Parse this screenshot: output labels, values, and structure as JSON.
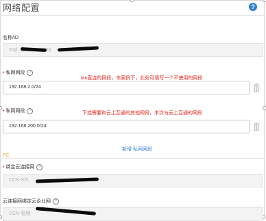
{
  "window": {
    "title": "网络配置"
  },
  "name_field": {
    "label": "名称/ID",
    "value_prefix": "sxgl",
    "value_mid": "sxg"
  },
  "private_segment_1": {
    "label": "私网网段",
    "value": "192.168.2.0/24",
    "annotation": "lan直连的网段，本案例下，此处可填写一个不使用的网段"
  },
  "private_segment_2": {
    "label": "私网网段",
    "value": "192.168.200.0/24",
    "annotation": "下挂需要和云上互通的其他网段，本次与云上互通的网段"
  },
  "add_private_segment": {
    "label": "新增 私网网段"
  },
  "section_tag": {
    "label": "PC"
  },
  "bind_ccn": {
    "label": "绑定云连接网",
    "value": "CCN-SZL"
  },
  "ccn_bound_enterprise": {
    "label": "云连接网绑定云企业网",
    "value": "CCN-管理"
  },
  "icons": {
    "help": "question-icon",
    "delete": "trash-icon"
  },
  "colors": {
    "required": "#e0262a",
    "annotation": "#e8231a",
    "link": "#2f7fd6",
    "tag": "#e8a23a"
  }
}
